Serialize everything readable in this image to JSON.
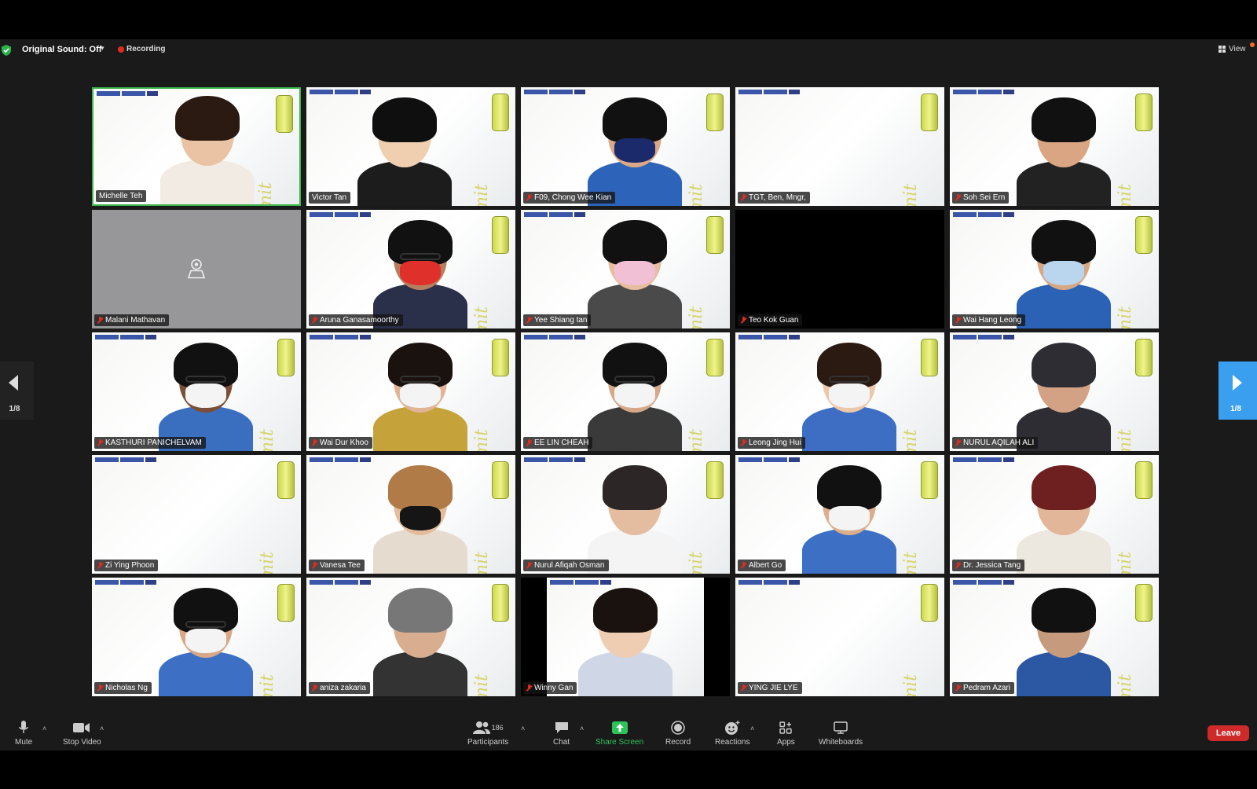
{
  "meeting": {
    "original_sound": "Original Sound: Off",
    "recording": "Recording",
    "view_label": "View",
    "page_indicator": "1/8",
    "page_indicator_right": "1/8"
  },
  "participants": [
    {
      "name": "Michelle Teh",
      "mic_muted": false,
      "video": true,
      "active": true
    },
    {
      "name": "Victor Tan",
      "mic_muted": false,
      "video": true
    },
    {
      "name": "F09, Chong Wee Kian",
      "mic_muted": true,
      "video": true
    },
    {
      "name": "TGT, Ben, Mngr,",
      "mic_muted": true,
      "video": true
    },
    {
      "name": "Soh Sei Ern",
      "mic_muted": true,
      "video": true
    },
    {
      "name": "Malani Mathavan",
      "mic_muted": true,
      "video": false
    },
    {
      "name": "Aruna Ganasamoorthy",
      "mic_muted": true,
      "video": true
    },
    {
      "name": "Yee Shiang tan",
      "mic_muted": true,
      "video": true
    },
    {
      "name": "Teo Kok Guan",
      "mic_muted": true,
      "video": true
    },
    {
      "name": "Wai Hang Leong",
      "mic_muted": true,
      "video": true
    },
    {
      "name": "KASTHURI PANICHELVAM",
      "mic_muted": true,
      "video": true
    },
    {
      "name": "Wai Dur Khoo",
      "mic_muted": true,
      "video": true
    },
    {
      "name": "EE LIN CHEAH",
      "mic_muted": true,
      "video": true
    },
    {
      "name": "Leong Jing Hui",
      "mic_muted": true,
      "video": true
    },
    {
      "name": "NURUL AQILAH ALI",
      "mic_muted": true,
      "video": true
    },
    {
      "name": "Zi Ying Phoon",
      "mic_muted": true,
      "video": true
    },
    {
      "name": "Vanesa Tee",
      "mic_muted": true,
      "video": true
    },
    {
      "name": "Nurul Afiqah Osman",
      "mic_muted": true,
      "video": true
    },
    {
      "name": "Albert Go",
      "mic_muted": true,
      "video": true
    },
    {
      "name": "Dr. Jessica Tang",
      "mic_muted": true,
      "video": true
    },
    {
      "name": "Nicholas Ng",
      "mic_muted": true,
      "video": true
    },
    {
      "name": "aniza zakaria",
      "mic_muted": true,
      "video": true
    },
    {
      "name": "Winny Gan",
      "mic_muted": true,
      "video": true
    },
    {
      "name": "YING JIE LYE",
      "mic_muted": true,
      "video": true
    },
    {
      "name": "Pedram Azari",
      "mic_muted": true,
      "video": true
    }
  ],
  "background": {
    "title": "LEARNING",
    "subtitle": "SERIES",
    "script": "Summit"
  },
  "toolbar": {
    "mute": "Mute",
    "stop_video": "Stop Video",
    "participants": "Participants",
    "participant_count": "186",
    "chat": "Chat",
    "share_screen": "Share Screen",
    "record": "Record",
    "reactions": "Reactions",
    "apps": "Apps",
    "whiteboards": "Whiteboards",
    "leave": "Leave"
  },
  "colors": {
    "active_speaker": "#3ab54a",
    "share_green": "#2dc35a",
    "leave_red": "#cf2a2a",
    "recording_red": "#e02b20",
    "nav_blue": "#3b9ff0"
  }
}
